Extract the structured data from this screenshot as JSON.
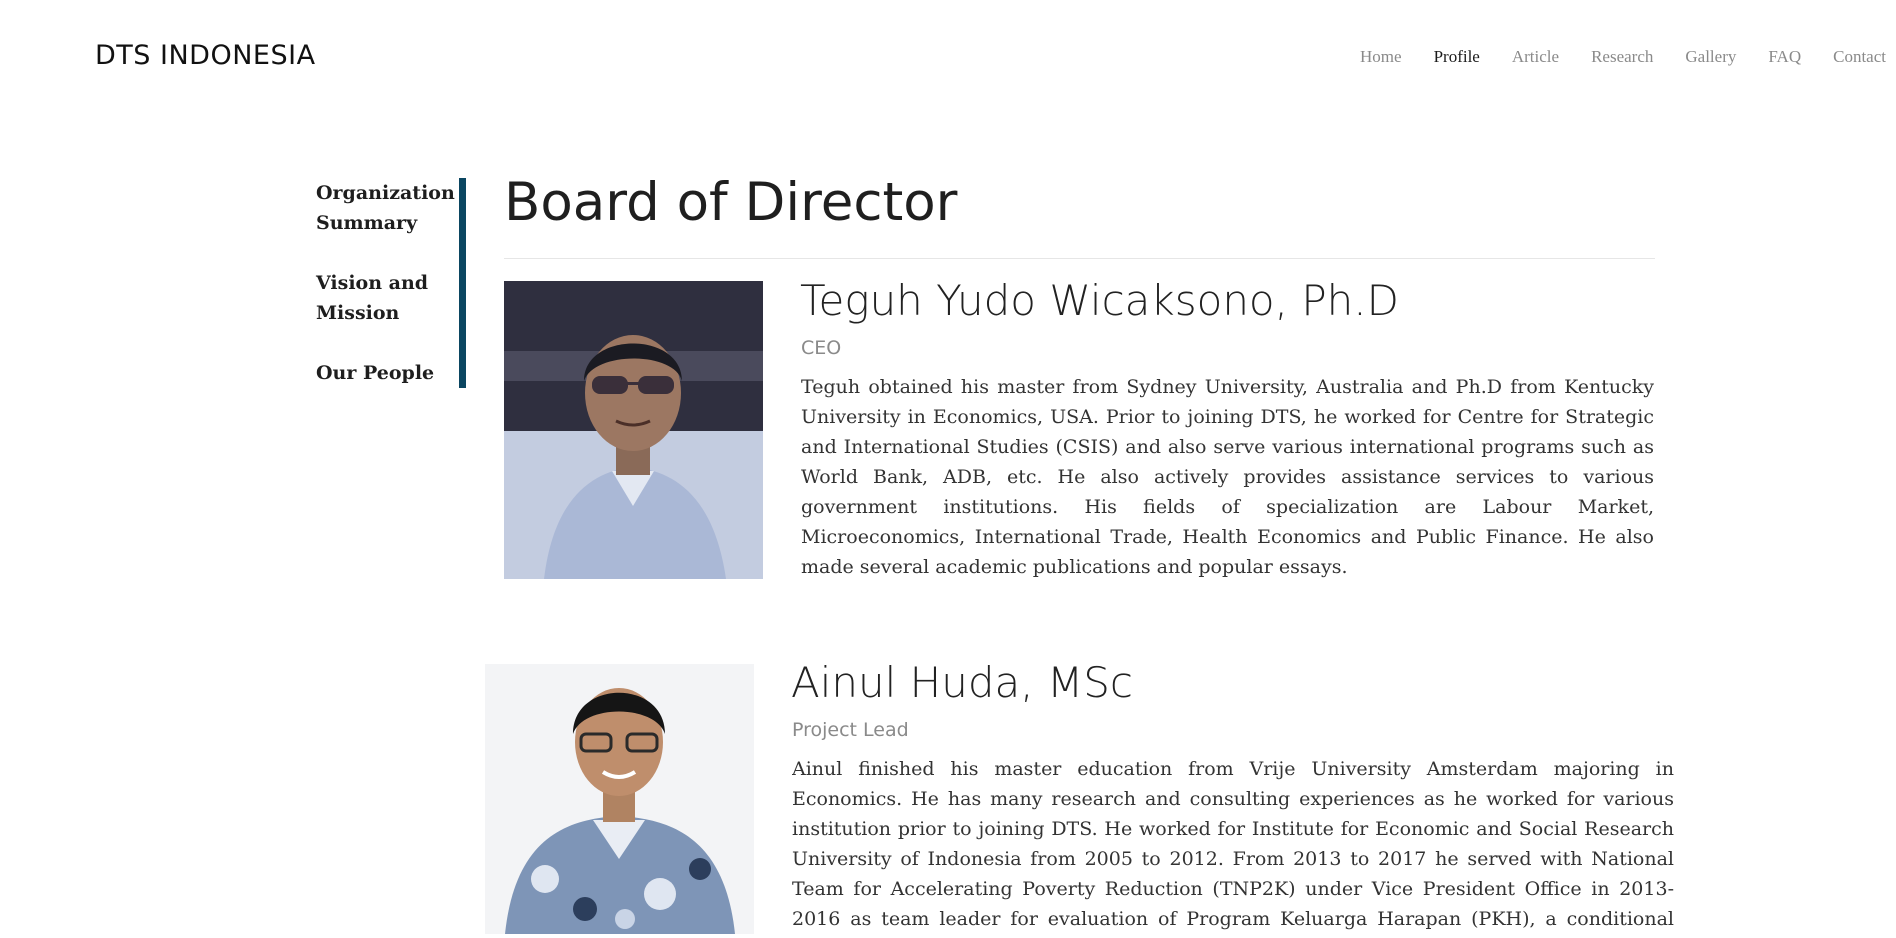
{
  "site": {
    "brand": "DTS INDONESIA"
  },
  "nav": {
    "items": [
      {
        "label": "Home"
      },
      {
        "label": "Profile",
        "active": true
      },
      {
        "label": "Article"
      },
      {
        "label": "Research"
      },
      {
        "label": "Gallery"
      },
      {
        "label": "FAQ"
      },
      {
        "label": "Contact"
      }
    ]
  },
  "sidebar": {
    "accent_color": "#0b4661",
    "items": [
      {
        "label": "Organization Summary"
      },
      {
        "label": "Vision and Mission"
      },
      {
        "label": "Our People"
      }
    ]
  },
  "main": {
    "title": "Board of Director",
    "people": [
      {
        "name": "Teguh Yudo Wicaksono, Ph.D",
        "role": "CEO",
        "bio": "Teguh obtained his master from Sydney University, Australia and Ph.D from Kentucky University in Economics, USA. Prior to joining DTS, he worked for Centre for Strategic and International Studies (CSIS) and also serve various international programs such as World Bank, ADB, etc. He also actively provides assistance services to various government institutions. His fields of specialization are Labour Market, Microeconomics, International Trade, Health Economics and Public Finance. He also made several academic publications and popular essays."
      },
      {
        "name": "Ainul Huda, MSc",
        "role": "Project Lead",
        "bio": "Ainul finished his master education from Vrije University Amsterdam majoring in Economics. He has many research and consulting experiences as he worked for various institution prior to joining DTS. He worked for Institute for Economic and Social Research University of Indonesia from 2005 to 2012. From 2013 to 2017 he served with National Team for Accelerating Poverty Reduction (TNP2K) under Vice President Office in 2013-2016 as team leader for evaluation of Program Keluarga Harapan (PKH), a conditional cash transfer program initiated by"
      }
    ]
  }
}
